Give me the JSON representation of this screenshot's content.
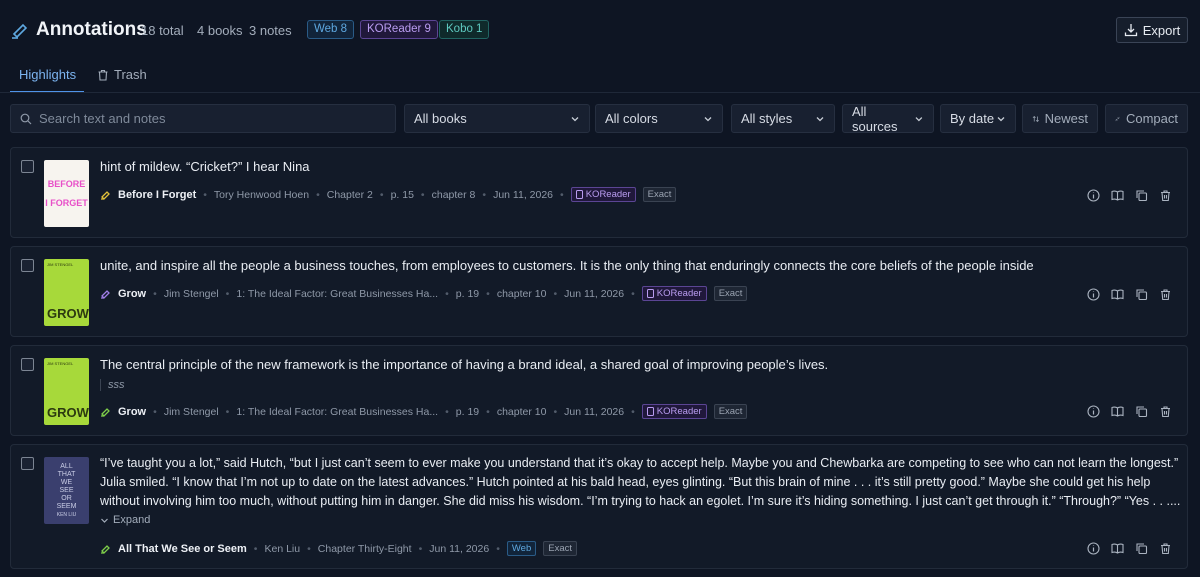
{
  "header": {
    "title": "Annotations",
    "total": "18 total",
    "books": "4 books",
    "notes": "3 notes",
    "source_pills": [
      "Web 8",
      "KOReader 9",
      "Kobo 1"
    ],
    "export_label": "Export"
  },
  "tabs": [
    {
      "label": "Highlights"
    },
    {
      "label": "Trash"
    }
  ],
  "filters": {
    "search_placeholder": "Search text and notes",
    "books": "All books",
    "colors": "All colors",
    "styles": "All styles",
    "sources": "All sources",
    "sort": "By date",
    "order": "Newest",
    "density": "Compact"
  },
  "annotations": [
    {
      "text": "hint of mildew. “Cricket?” I hear Nina",
      "book": "Before I Forget",
      "author": "Tory Henwood Hoen",
      "chapter": "Chapter 2",
      "page": "p. 15",
      "section": "chapter 8",
      "date": "Jun 11, 2026",
      "source": "KOReader",
      "match": "Exact",
      "cover_text": [
        "BEFORE",
        "I FORGET"
      ],
      "cover_color": "#f7f4ef"
    },
    {
      "text": "unite, and inspire all the people a business touches, from employees to customers. It is the only thing that enduringly connects the core beliefs of the people inside",
      "book": "Grow",
      "author": "Jim Stengel",
      "chapter": "1: The Ideal Factor: Great Businesses Ha...",
      "page": "p. 19",
      "section": "chapter 10",
      "date": "Jun 11, 2026",
      "source": "KOReader",
      "match": "Exact",
      "cover_text": [
        "JIM STENGEL",
        "GROW"
      ],
      "cover_color": "#a7d93a"
    },
    {
      "text": "The central principle of the new framework is the importance of having a brand ideal, a shared goal of improving people’s lives.",
      "note": "sss",
      "book": "Grow",
      "author": "Jim Stengel",
      "chapter": "1: The Ideal Factor: Great Businesses Ha...",
      "page": "p. 19",
      "section": "chapter 10",
      "date": "Jun 11, 2026",
      "source": "KOReader",
      "match": "Exact",
      "cover_text": [
        "JIM STENGEL",
        "GROW"
      ],
      "cover_color": "#a7d93a"
    },
    {
      "text_lines": [
        "“I’ve taught you a lot,” said Hutch, “but I just can’t seem to ever make you understand that it’s okay to accept help. Maybe you and Chewbarka are competing to see who can not learn the longest.”",
        "Julia smiled. “I know that I’m not up to date on the latest advances.” Hutch pointed at his bald head, eyes glinting. “But this brain of mine . . . it’s still pretty good.” Maybe she could get his help",
        "without involving him too much, without putting him in danger. She did miss his wisdom. “I’m trying to hack an egolet. I’m sure it’s hiding something. I just can’t get through it.” “Through?” “Yes . . ...."
      ],
      "expand_label": "Expand",
      "book": "All That We See or Seem",
      "author": "Ken Liu",
      "chapter": "Chapter Thirty-Eight",
      "date": "Jun 11, 2026",
      "source": "Web",
      "match": "Exact",
      "cover_text": [
        "ALL",
        "THAT",
        "WE",
        "SEE",
        "OR",
        "SEEM",
        "KEN LIU"
      ],
      "cover_color": "#3a3f6e"
    }
  ],
  "colors": {
    "accent": "#4f93e8",
    "web": "#5ea8e0",
    "koreader": "#b99cf0",
    "kobo": "#5ec9c0",
    "highlight_yellow": "#e3c23a",
    "highlight_purple": "#a17ee8",
    "highlight_green": "#7fcf4a"
  },
  "icons": {
    "header": "highlighter-icon",
    "export": "download-icon",
    "trash": "trash-icon",
    "search": "search-icon",
    "order": "sort-icon",
    "density": "collapse-icon",
    "row_actions": [
      "info-icon",
      "book-open-icon",
      "copy-icon",
      "delete-icon"
    ]
  }
}
